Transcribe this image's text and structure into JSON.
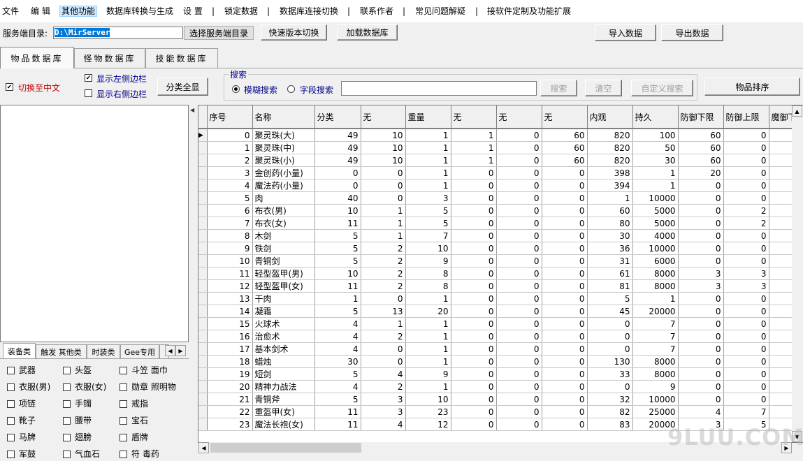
{
  "menu": {
    "items": [
      "文件",
      "编 辑",
      "其他功能",
      "数据库转换与生成",
      "设 置",
      "锁定数据",
      "数据库连接切换",
      "联系作者",
      "常见问题解疑",
      "接软件定制及功能扩展"
    ],
    "separator": "|"
  },
  "toolbar": {
    "server_dir_label": "服务端目录:",
    "server_path": "D:\\MirServer",
    "select_dir_button": "选择服务端目录",
    "quick_version_button": "快速版本切换",
    "load_db_button": "加载数据库",
    "import_button": "导入数据",
    "export_button": "导出数据"
  },
  "tabs": [
    "物品数据库",
    "怪物数据库",
    "技能数据库"
  ],
  "options": {
    "switch_chinese": "切换至中文",
    "show_left": "显示左侧边栏",
    "show_right": "显示右侧边栏",
    "show_all_button": "分类全显",
    "sort_button": "物品排序"
  },
  "search": {
    "legend": "搜索",
    "fuzzy": "模糊搜索",
    "field": "字段搜索",
    "search_button": "搜索",
    "clear_button": "清空",
    "custom_button": "自定义搜索"
  },
  "subtabs": [
    "装备类",
    "触发 其他类",
    "时装类",
    "Gee专用"
  ],
  "categories": [
    [
      "武器",
      "头盔",
      "斗笠 面巾"
    ],
    [
      "衣服(男)",
      "衣服(女)",
      "勋章 照明物"
    ],
    [
      "项链",
      "手镯",
      "戒指"
    ],
    [
      "靴子",
      "腰带",
      "宝石"
    ],
    [
      "马牌",
      "翅膀",
      "盾牌"
    ],
    [
      "军鼓",
      "气血石",
      "符 毒药"
    ]
  ],
  "grid": {
    "columns": [
      "序号",
      "名称",
      "分类",
      "无",
      "重量",
      "无",
      "无",
      "无",
      "内观",
      "持久",
      "防御下限",
      "防御上限",
      "魔御下"
    ],
    "rows": [
      [
        "0",
        "聚灵珠(大)",
        "49",
        "10",
        "1",
        "1",
        "0",
        "60",
        "820",
        "100",
        "60",
        "0"
      ],
      [
        "1",
        "聚灵珠(中)",
        "49",
        "10",
        "1",
        "1",
        "0",
        "60",
        "820",
        "50",
        "60",
        "0"
      ],
      [
        "2",
        "聚灵珠(小)",
        "49",
        "10",
        "1",
        "1",
        "0",
        "60",
        "820",
        "30",
        "60",
        "0"
      ],
      [
        "3",
        "金创药(小量)",
        "0",
        "0",
        "1",
        "0",
        "0",
        "0",
        "398",
        "1",
        "20",
        "0"
      ],
      [
        "4",
        "魔法药(小量)",
        "0",
        "0",
        "1",
        "0",
        "0",
        "0",
        "394",
        "1",
        "0",
        "0"
      ],
      [
        "5",
        "肉",
        "40",
        "0",
        "3",
        "0",
        "0",
        "0",
        "1",
        "10000",
        "0",
        "0"
      ],
      [
        "6",
        "布衣(男)",
        "10",
        "1",
        "5",
        "0",
        "0",
        "0",
        "60",
        "5000",
        "0",
        "2"
      ],
      [
        "7",
        "布衣(女)",
        "11",
        "1",
        "5",
        "0",
        "0",
        "0",
        "80",
        "5000",
        "0",
        "2"
      ],
      [
        "8",
        "木剑",
        "5",
        "1",
        "7",
        "0",
        "0",
        "0",
        "30",
        "4000",
        "0",
        "0"
      ],
      [
        "9",
        "铁剑",
        "5",
        "2",
        "10",
        "0",
        "0",
        "0",
        "36",
        "10000",
        "0",
        "0"
      ],
      [
        "10",
        "青铜剑",
        "5",
        "2",
        "9",
        "0",
        "0",
        "0",
        "31",
        "6000",
        "0",
        "0"
      ],
      [
        "11",
        "轻型盔甲(男)",
        "10",
        "2",
        "8",
        "0",
        "0",
        "0",
        "61",
        "8000",
        "3",
        "3"
      ],
      [
        "12",
        "轻型盔甲(女)",
        "11",
        "2",
        "8",
        "0",
        "0",
        "0",
        "81",
        "8000",
        "3",
        "3"
      ],
      [
        "13",
        "干肉",
        "1",
        "0",
        "1",
        "0",
        "0",
        "0",
        "5",
        "1",
        "0",
        "0"
      ],
      [
        "14",
        "凝霜",
        "5",
        "13",
        "20",
        "0",
        "0",
        "0",
        "45",
        "20000",
        "0",
        "0"
      ],
      [
        "15",
        "火球术",
        "4",
        "1",
        "1",
        "0",
        "0",
        "0",
        "0",
        "7",
        "0",
        "0"
      ],
      [
        "16",
        "治愈术",
        "4",
        "2",
        "1",
        "0",
        "0",
        "0",
        "0",
        "7",
        "0",
        "0"
      ],
      [
        "17",
        "基本剑术",
        "4",
        "0",
        "1",
        "0",
        "0",
        "0",
        "0",
        "7",
        "0",
        "0"
      ],
      [
        "18",
        "蜡烛",
        "30",
        "0",
        "1",
        "0",
        "0",
        "0",
        "130",
        "8000",
        "0",
        "0"
      ],
      [
        "19",
        "短剑",
        "5",
        "4",
        "9",
        "0",
        "0",
        "0",
        "33",
        "8000",
        "0",
        "0"
      ],
      [
        "20",
        "精神力战法",
        "4",
        "2",
        "1",
        "0",
        "0",
        "0",
        "0",
        "9",
        "0",
        "0"
      ],
      [
        "21",
        "青铜斧",
        "5",
        "3",
        "10",
        "0",
        "0",
        "0",
        "32",
        "10000",
        "0",
        "0"
      ],
      [
        "22",
        "重盔甲(女)",
        "11",
        "3",
        "23",
        "0",
        "0",
        "0",
        "82",
        "25000",
        "4",
        "7"
      ],
      [
        "23",
        "魔法长袍(女)",
        "11",
        "4",
        "12",
        "0",
        "0",
        "0",
        "83",
        "20000",
        "3",
        "5"
      ]
    ]
  },
  "watermark": "9LUU.COM"
}
